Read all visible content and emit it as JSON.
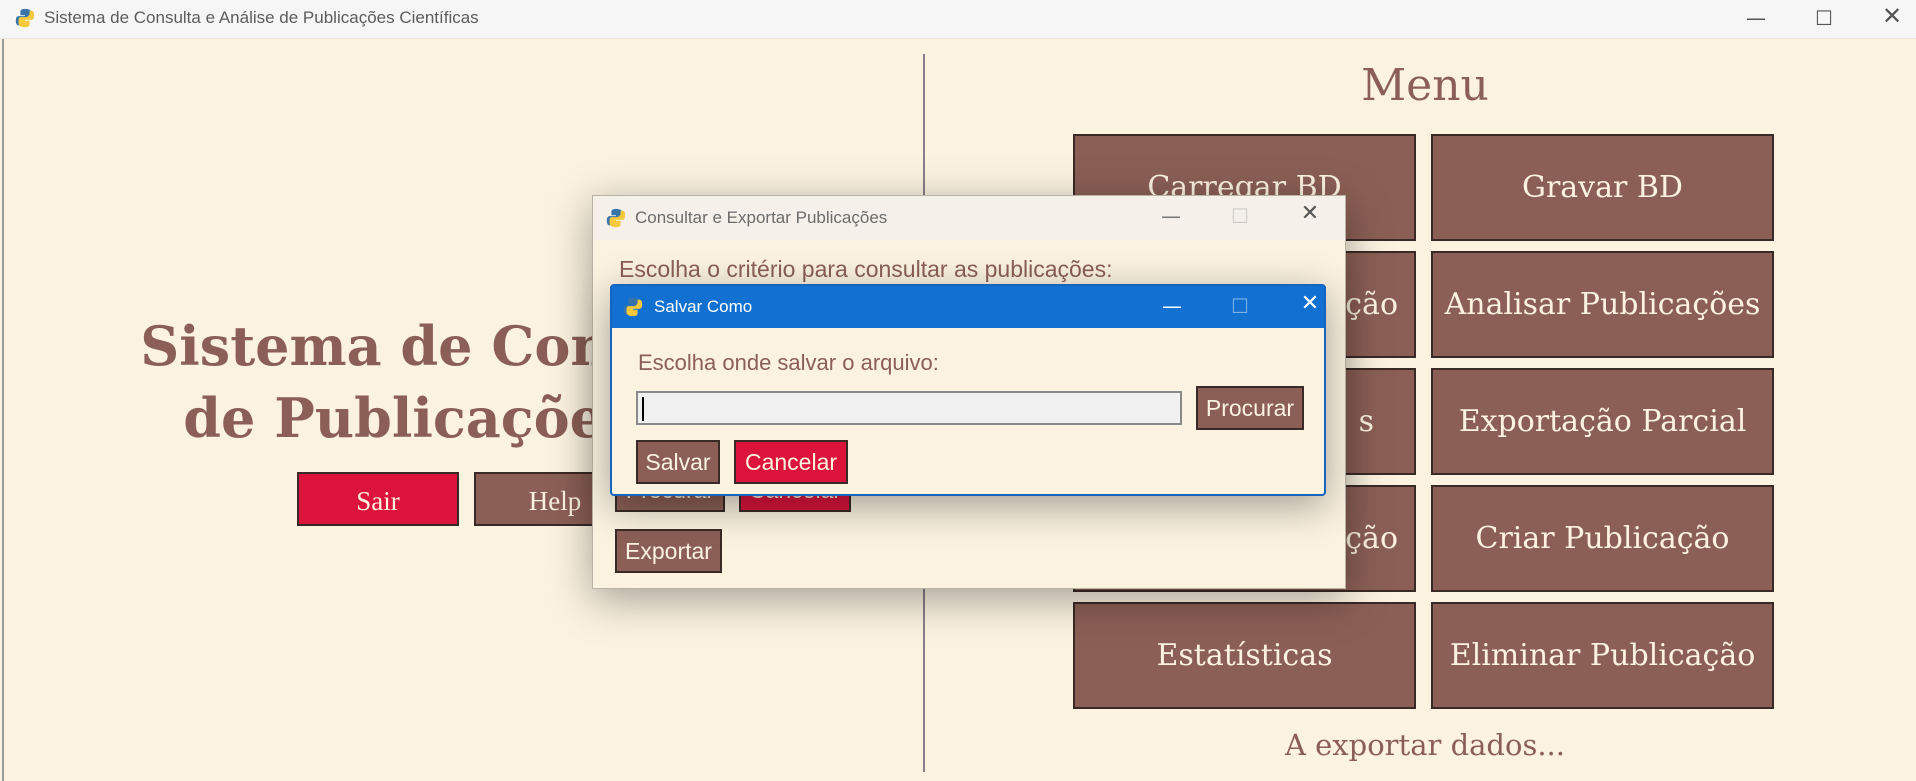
{
  "window": {
    "title": "Sistema de Consulta e Análise de Publicações Científicas",
    "controls": [
      "minimize-icon",
      "maximize-icon",
      "close-icon"
    ]
  },
  "left": {
    "title_line1": "Sistema de Consulta",
    "title_line2": "de Publicações Ci",
    "sair_label": "Sair",
    "help_label": "Help"
  },
  "menu": {
    "title": "Menu",
    "buttons": [
      "Carregar BD",
      "Gravar BD",
      "ção",
      "Analisar Publicações",
      "s",
      "Exportação Parcial",
      "ção",
      "Criar Publicação",
      "Estatísticas",
      "Eliminar Publicação"
    ],
    "status": "A exportar dados..."
  },
  "dialog_consultar": {
    "title": "Consultar e Exportar Publicações",
    "prompt": "Escolha o critério para consultar as publicações:",
    "procurar_label": "Procurar",
    "cancelar_label": "Cancelar",
    "exportar_label": "Exportar"
  },
  "dialog_salvar": {
    "title": "Salvar Como",
    "prompt": "Escolha onde salvar o arquivo:",
    "path_value": "",
    "procurar_label": "Procurar",
    "salvar_label": "Salvar",
    "cancelar_label": "Cancelar"
  },
  "colors": {
    "background": "#fbf2e0",
    "button_brown": "#8b5f55",
    "button_red": "#dc143c",
    "accent_blue": "#1270d0"
  }
}
